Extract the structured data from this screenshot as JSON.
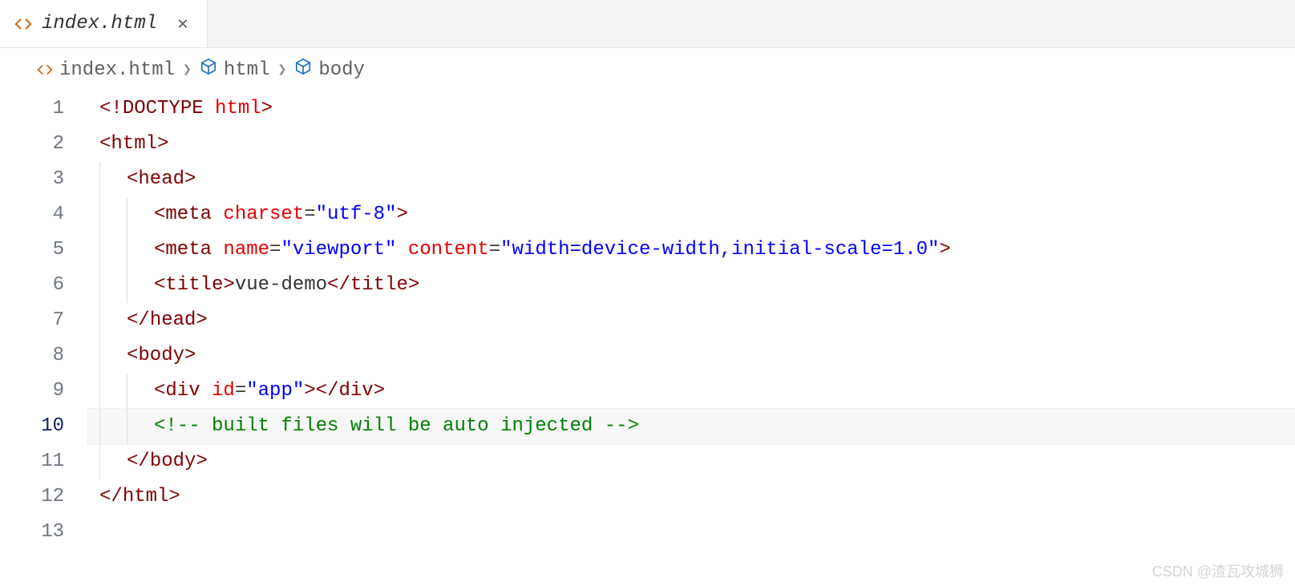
{
  "tab": {
    "filename": "index.html"
  },
  "breadcrumbs": {
    "file": "index.html",
    "segments": [
      "html",
      "body"
    ]
  },
  "code": {
    "lines": [
      {
        "n": 1,
        "indent": 0,
        "active": false,
        "tokens": [
          {
            "t": "<!",
            "c": "punct"
          },
          {
            "t": "DOCTYPE",
            "c": "tag"
          },
          {
            "t": " ",
            "c": "text"
          },
          {
            "t": "html",
            "c": "attr"
          },
          {
            "t": ">",
            "c": "punct"
          }
        ]
      },
      {
        "n": 2,
        "indent": 0,
        "active": false,
        "tokens": [
          {
            "t": "<",
            "c": "punct"
          },
          {
            "t": "html",
            "c": "tag"
          },
          {
            "t": ">",
            "c": "punct"
          }
        ]
      },
      {
        "n": 3,
        "indent": 1,
        "active": false,
        "tokens": [
          {
            "t": "<",
            "c": "punct"
          },
          {
            "t": "head",
            "c": "tag"
          },
          {
            "t": ">",
            "c": "punct"
          }
        ]
      },
      {
        "n": 4,
        "indent": 2,
        "active": false,
        "tokens": [
          {
            "t": "<",
            "c": "punct"
          },
          {
            "t": "meta",
            "c": "tag"
          },
          {
            "t": " ",
            "c": "text"
          },
          {
            "t": "charset",
            "c": "attr"
          },
          {
            "t": "=",
            "c": "eq"
          },
          {
            "t": "\"utf-8\"",
            "c": "str"
          },
          {
            "t": ">",
            "c": "punct"
          }
        ]
      },
      {
        "n": 5,
        "indent": 2,
        "active": false,
        "tokens": [
          {
            "t": "<",
            "c": "punct"
          },
          {
            "t": "meta",
            "c": "tag"
          },
          {
            "t": " ",
            "c": "text"
          },
          {
            "t": "name",
            "c": "attr"
          },
          {
            "t": "=",
            "c": "eq"
          },
          {
            "t": "\"viewport\"",
            "c": "str"
          },
          {
            "t": " ",
            "c": "text"
          },
          {
            "t": "content",
            "c": "attr"
          },
          {
            "t": "=",
            "c": "eq"
          },
          {
            "t": "\"width=device-width,initial-scale=1.0\"",
            "c": "str"
          },
          {
            "t": ">",
            "c": "punct"
          }
        ]
      },
      {
        "n": 6,
        "indent": 2,
        "active": false,
        "tokens": [
          {
            "t": "<",
            "c": "punct"
          },
          {
            "t": "title",
            "c": "tag"
          },
          {
            "t": ">",
            "c": "punct"
          },
          {
            "t": "vue-demo",
            "c": "text"
          },
          {
            "t": "</",
            "c": "punct"
          },
          {
            "t": "title",
            "c": "tag"
          },
          {
            "t": ">",
            "c": "punct"
          }
        ]
      },
      {
        "n": 7,
        "indent": 1,
        "active": false,
        "tokens": [
          {
            "t": "</",
            "c": "punct"
          },
          {
            "t": "head",
            "c": "tag"
          },
          {
            "t": ">",
            "c": "punct"
          }
        ]
      },
      {
        "n": 8,
        "indent": 1,
        "active": false,
        "tokens": [
          {
            "t": "<",
            "c": "punct"
          },
          {
            "t": "body",
            "c": "tag"
          },
          {
            "t": ">",
            "c": "punct"
          }
        ]
      },
      {
        "n": 9,
        "indent": 2,
        "active": false,
        "tokens": [
          {
            "t": "<",
            "c": "punct"
          },
          {
            "t": "div",
            "c": "tag"
          },
          {
            "t": " ",
            "c": "text"
          },
          {
            "t": "id",
            "c": "attr"
          },
          {
            "t": "=",
            "c": "eq"
          },
          {
            "t": "\"app\"",
            "c": "str"
          },
          {
            "t": ">",
            "c": "punct"
          },
          {
            "t": "</",
            "c": "punct"
          },
          {
            "t": "div",
            "c": "tag"
          },
          {
            "t": ">",
            "c": "punct"
          }
        ]
      },
      {
        "n": 10,
        "indent": 2,
        "active": true,
        "tokens": [
          {
            "t": "<!-- built files will be auto injected -->",
            "c": "comment"
          }
        ]
      },
      {
        "n": 11,
        "indent": 1,
        "active": false,
        "tokens": [
          {
            "t": "</",
            "c": "punct"
          },
          {
            "t": "body",
            "c": "tag"
          },
          {
            "t": ">",
            "c": "punct"
          }
        ]
      },
      {
        "n": 12,
        "indent": 0,
        "active": false,
        "tokens": [
          {
            "t": "</",
            "c": "punct"
          },
          {
            "t": "html",
            "c": "tag"
          },
          {
            "t": ">",
            "c": "punct"
          }
        ]
      },
      {
        "n": 13,
        "indent": 0,
        "active": false,
        "tokens": []
      }
    ]
  },
  "watermark": "CSDN @渣瓦攻城狮"
}
